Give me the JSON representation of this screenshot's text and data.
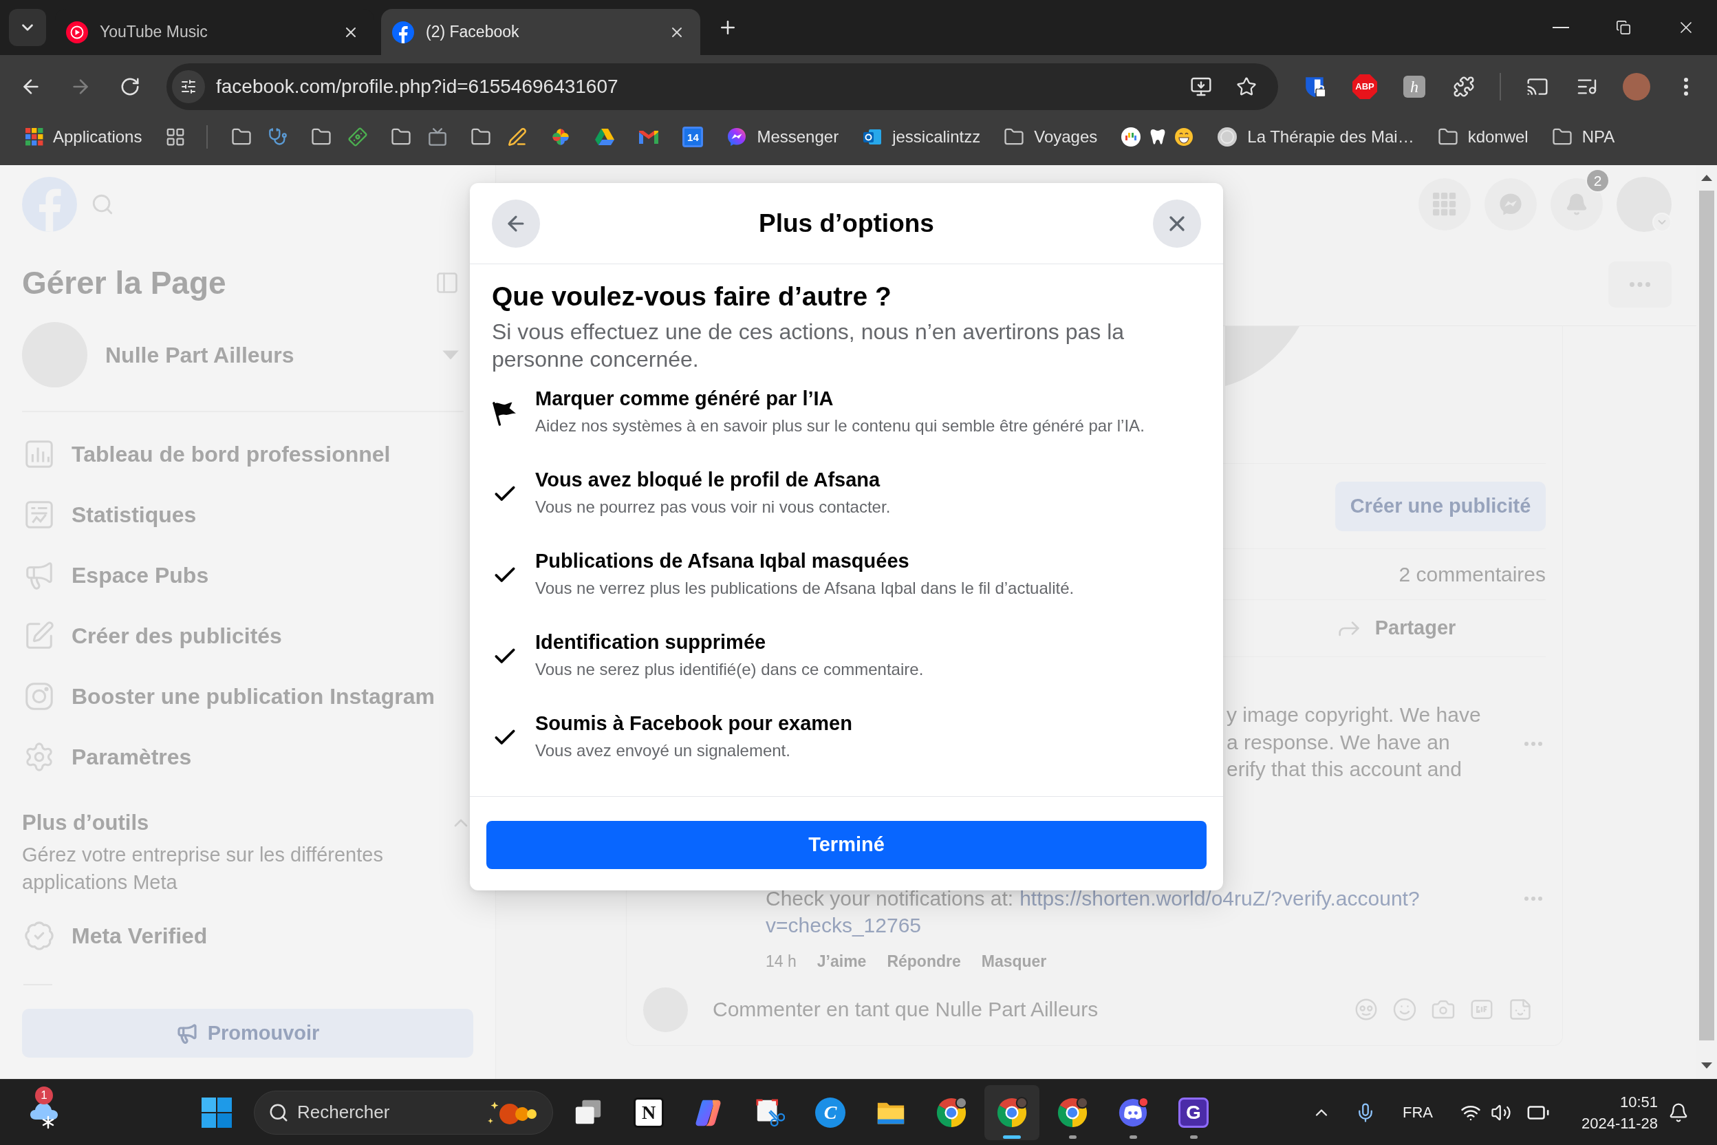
{
  "browser": {
    "tabs": [
      {
        "kind": "youtube-music",
        "title": "YouTube Music",
        "selected": false
      },
      {
        "kind": "facebook",
        "title": "(2) Facebook",
        "selected": true
      }
    ],
    "address": {
      "url": "facebook.com/profile.php?id=61554696431607"
    },
    "extensions": [
      {
        "kind": "shield-lock"
      },
      {
        "kind": "stop-sign",
        "label": "ABP"
      },
      {
        "kind": "letter-tile",
        "label": "h"
      },
      {
        "kind": "puzzle"
      }
    ],
    "bookmarks": {
      "pinned": [
        {
          "kind": "apps",
          "label": "Applications"
        },
        {
          "kind": "tab-groups"
        }
      ],
      "items": [
        {
          "kind": "folder-stethoscope"
        },
        {
          "kind": "folder-money"
        },
        {
          "kind": "folder-tv"
        },
        {
          "kind": "folder-writing"
        },
        {
          "kind": "pinwheel"
        },
        {
          "kind": "drive"
        },
        {
          "kind": "mail"
        },
        {
          "kind": "calendar",
          "label": "14"
        },
        {
          "kind": "messenger",
          "label": "Messenger"
        },
        {
          "kind": "outlook",
          "label": "jessicalintzz"
        },
        {
          "kind": "folder",
          "label": "Voyages"
        },
        {
          "kind": "palette-tooth-grin"
        },
        {
          "kind": "site",
          "label": "La Thérapie des Mai…"
        },
        {
          "kind": "folder",
          "label": "kdonwel"
        },
        {
          "kind": "folder",
          "label": "NPA"
        }
      ]
    }
  },
  "facebook": {
    "notification_count": "2",
    "sidebar": {
      "title": "Gérer la Page",
      "page_name": "Nulle Part Ailleurs",
      "menu": [
        {
          "kind": "dashboard",
          "label": "Tableau de bord professionnel"
        },
        {
          "kind": "insights",
          "label": "Statistiques"
        },
        {
          "kind": "megaphone",
          "label": "Espace Pubs"
        },
        {
          "kind": "edit",
          "label": "Créer des publicités"
        },
        {
          "kind": "instagram",
          "label": "Booster une publication Instagram"
        },
        {
          "kind": "settings",
          "label": "Paramètres"
        }
      ],
      "tools": {
        "title": "Plus d’outils",
        "expanded": true,
        "description": "Gérez votre entreprise sur les différentes applications Meta",
        "items": [
          {
            "kind": "verified",
            "label": "Meta Verified"
          }
        ]
      },
      "promote_button": "Promouvoir"
    },
    "post": {
      "create_ad_button": "Créer une publicité",
      "comment_count": "2 commentaires",
      "share_label": "Partager",
      "comment_fragment": {
        "lines": [
          "y image copyright. We have",
          "a response. We have an",
          "erify that this account and"
        ]
      },
      "comment": {
        "text": "Check your notifications at:",
        "link_lines": [
          "https://shorten.world/o4ruZ/?verify.account?",
          "v=checks_12765"
        ],
        "time": "14 h",
        "actions": [
          "J’aime",
          "Répondre",
          "Masquer"
        ]
      },
      "composer": {
        "placeholder": "Commenter en tant que Nulle Part Ailleurs"
      }
    }
  },
  "dialog": {
    "title": "Plus d’options",
    "heading": "Que voulez-vous faire d’autre ?",
    "subtitle": "Si vous effectuez une de ces actions, nous n’en avertirons pas la personne concernée.",
    "actions": [
      {
        "kind": "flag",
        "title": "Marquer comme généré par l’IA",
        "description": "Aidez nos systèmes à en savoir plus sur le contenu qui semble être généré par l’IA."
      },
      {
        "kind": "done",
        "title": "Vous avez bloqué le profil de Afsana",
        "description": "Vous ne pourrez pas vous voir ni vous contacter."
      },
      {
        "kind": "done",
        "title": "Publications de Afsana Iqbal masquées",
        "description": "Vous ne verrez plus les publications de Afsana Iqbal dans le fil d’actualité."
      },
      {
        "kind": "done",
        "title": "Identification supprimée",
        "description": "Vous ne serez plus identifié(e) dans ce commentaire."
      },
      {
        "kind": "done",
        "title": "Soumis à Facebook pour examen",
        "description": "Vous avez envoyé un signalement."
      }
    ],
    "done_button": "Terminé"
  },
  "taskbar": {
    "weather_badge": "1",
    "search": {
      "placeholder": "Rechercher"
    },
    "apps": [
      {
        "kind": "task-view",
        "selected": false,
        "running": false
      },
      {
        "kind": "notion",
        "glyph": "N",
        "selected": false,
        "running": false
      },
      {
        "kind": "copilot",
        "selected": false,
        "running": false
      },
      {
        "kind": "snipping",
        "selected": false,
        "running": false
      },
      {
        "kind": "canva",
        "glyph": "C",
        "selected": false,
        "running": false
      },
      {
        "kind": "files",
        "selected": false,
        "running": false
      },
      {
        "kind": "chrome",
        "selected": false,
        "running": false
      },
      {
        "kind": "chrome-profile",
        "selected": true,
        "running": true
      },
      {
        "kind": "chrome-profile",
        "selected": false,
        "running": true
      },
      {
        "kind": "discord",
        "selected": false,
        "running": true
      },
      {
        "kind": "g-app",
        "glyph": "G",
        "selected": false,
        "running": true
      }
    ],
    "tray": {
      "language": "FRA",
      "time": "10:51",
      "date": "2024-11-28"
    }
  }
}
